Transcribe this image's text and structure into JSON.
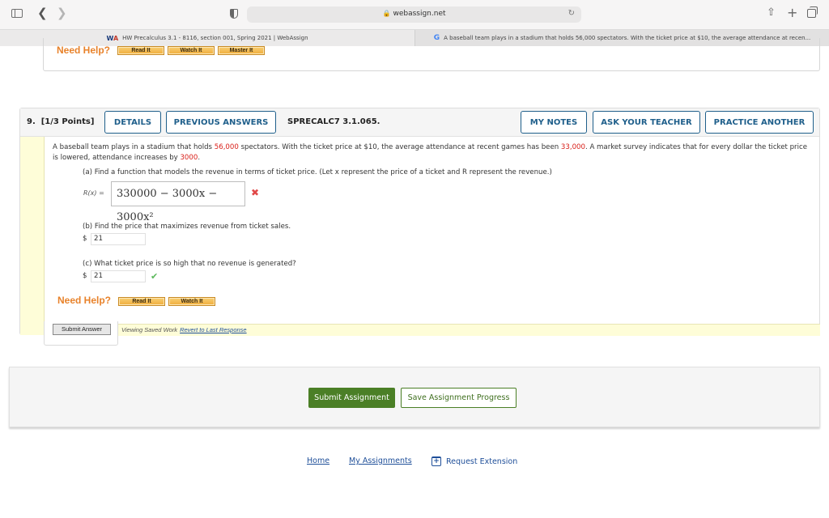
{
  "browser": {
    "url": "webassign.net",
    "tabs": [
      {
        "title": "HW Precalculus 3.1 - 8116, section 001, Spring 2021 | WebAssign",
        "icon": "webassign-logo"
      },
      {
        "title": "A baseball team plays in a stadium that holds 56,000 spectators. With the ticket price at $10, the average attendance at recen...",
        "icon": "google-logo"
      }
    ]
  },
  "previous_question": {
    "need_help_label": "Need Help?",
    "help_buttons": [
      "Read It",
      "Watch It",
      "Master It"
    ]
  },
  "question": {
    "number": "9.",
    "points": "[1/3 Points]",
    "buttons": {
      "details": "DETAILS",
      "previous_answers": "PREVIOUS ANSWERS",
      "my_notes": "MY NOTES",
      "ask_teacher": "ASK YOUR TEACHER",
      "practice_another": "PRACTICE ANOTHER"
    },
    "code": "SPRECALC7 3.1.065.",
    "text": {
      "p1": "A baseball team plays in a stadium that holds ",
      "capacity": "56,000",
      "p2": " spectators. With the ticket price at $10, the average attendance at recent games has been ",
      "attendance": "33,000",
      "p3": ". A market survey indicates that for every dollar the ticket price is lowered, attendance increases by ",
      "increase": "3000",
      "p4": "."
    },
    "part_a": {
      "prompt": "(a) Find a function that models the revenue in terms of ticket price. (Let x represent the price of a ticket and R represent the revenue.)",
      "label": "R(x) =",
      "answer": "330000 − 3000x − 3000x²",
      "status": "incorrect"
    },
    "part_b": {
      "prompt": "(b) Find the price that maximizes revenue from ticket sales.",
      "currency": "$",
      "answer": "21"
    },
    "part_c": {
      "prompt": "(c) What ticket price is so high that no revenue is generated?",
      "currency": "$",
      "answer": "21",
      "status": "correct"
    },
    "need_help_label": "Need Help?",
    "help_buttons": [
      "Read It",
      "Watch It"
    ],
    "saved_work_text": "Viewing Saved Work",
    "revert_link": "Revert to Last Response",
    "submit_answer": "Submit Answer"
  },
  "assignment": {
    "submit": "Submit Assignment",
    "save": "Save Assignment Progress"
  },
  "footer": {
    "home": "Home",
    "my_assignments": "My Assignments",
    "request_extension": "Request Extension"
  },
  "colors": {
    "accent_blue": "#1f5f8b",
    "help_orange": "#e8822a",
    "red_value": "#d9201a",
    "green_primary": "#4b7f26"
  }
}
